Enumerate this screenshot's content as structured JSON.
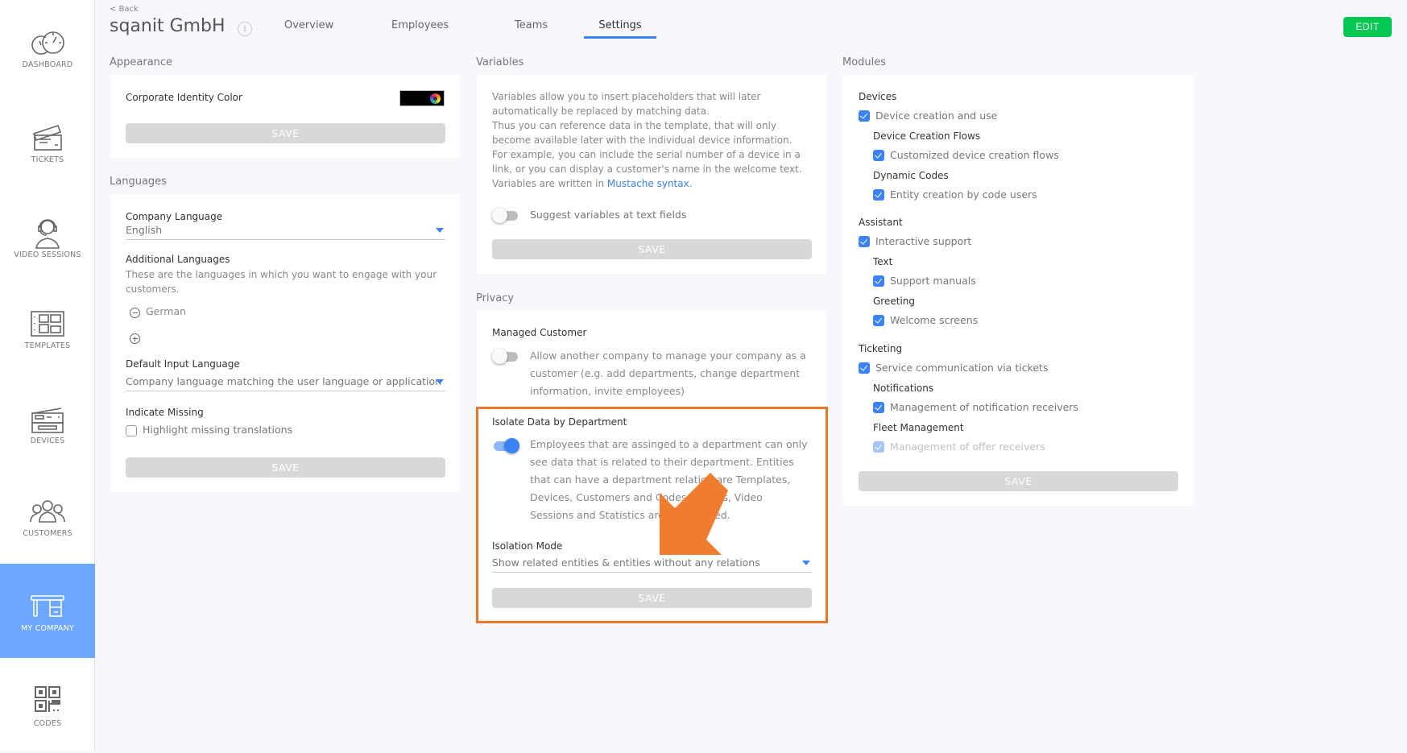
{
  "sidebar": {
    "items": [
      {
        "label": "DASHBOARD",
        "icon": "dashboard-gauge-icon",
        "active": false
      },
      {
        "label": "TICKETS",
        "icon": "tickets-icon",
        "active": false
      },
      {
        "label": "VIDEO SESSIONS",
        "icon": "headset-agent-icon",
        "active": false
      },
      {
        "label": "TEMPLATES",
        "icon": "templates-icon",
        "active": false
      },
      {
        "label": "DEVICES",
        "icon": "printer-device-icon",
        "active": false
      },
      {
        "label": "CUSTOMERS",
        "icon": "users-group-icon",
        "active": false
      },
      {
        "label": "MY COMPANY",
        "icon": "desk-icon",
        "active": true
      },
      {
        "label": "CODES",
        "icon": "qr-code-icon",
        "active": false
      }
    ]
  },
  "header": {
    "back_label": "< Back",
    "title": "sqanit GmbH",
    "info_icon": "i",
    "tabs": [
      {
        "label": "Overview",
        "active": false
      },
      {
        "label": "Employees",
        "active": false
      },
      {
        "label": "Teams",
        "active": false
      },
      {
        "label": "Settings",
        "active": true
      }
    ],
    "edit_label": "EDIT"
  },
  "appearance": {
    "title": "Appearance",
    "color_label": "Corporate Identity Color",
    "color_value": "#000000",
    "save_label": "SAVE"
  },
  "languages": {
    "title": "Languages",
    "company_language_label": "Company Language",
    "company_language_value": "English",
    "additional_label": "Additional Languages",
    "additional_desc": "These are the languages in which you want to engage with your customers.",
    "additional_items": [
      "German"
    ],
    "default_input_label": "Default Input Language",
    "default_input_value": "Company language matching the user language or application language",
    "indicate_missing_label": "Indicate Missing",
    "highlight_label": "Highlight missing translations",
    "highlight_checked": false,
    "save_label": "SAVE"
  },
  "variables": {
    "title": "Variables",
    "desc_line1": "Variables allow you to insert placeholders that will later automatically be replaced by matching data.",
    "desc_line2": "Thus you can reference data in the template, that will only become available later with the individual device information.",
    "desc_line3": "For example, you can include the serial number of a device in a link, or you can display a customer's name in the welcome text.",
    "desc_line4_prefix": "Variables are written in ",
    "desc_link": "Mustache syntax",
    "desc_line4_suffix": ".",
    "suggest_label": "Suggest variables at text fields",
    "suggest_on": false,
    "save_label": "SAVE"
  },
  "privacy": {
    "title": "Privacy",
    "managed_label": "Managed Customer",
    "managed_desc": "Allow another company to manage your company as a customer (e.g. add departments, change department information, invite employees)",
    "managed_on": false,
    "isolate_label": "Isolate Data by Department",
    "isolate_desc": "Employees that are assinged to a department can only see data that is related to their department. Entities that can have a department relation are Templates, Devices, Customers and Codes. Tickets, Video Sessions and Statistics are also filtered.",
    "isolate_on": true,
    "isolation_mode_label": "Isolation Mode",
    "isolation_mode_value": "Show related entities & entities without any relations",
    "save_label": "SAVE"
  },
  "modules": {
    "title": "Modules",
    "groups": [
      {
        "heading": "Devices",
        "item": "Device creation and use",
        "sub": [
          {
            "heading": "Device Creation Flows",
            "item": "Customized device creation flows"
          },
          {
            "heading": "Dynamic Codes",
            "item": "Entity creation by code users"
          }
        ]
      },
      {
        "heading": "Assistant",
        "item": "Interactive support",
        "sub": [
          {
            "heading": "Text",
            "item": "Support manuals"
          },
          {
            "heading": "Greeting",
            "item": "Welcome screens"
          }
        ]
      },
      {
        "heading": "Ticketing",
        "item": "Service communication via tickets",
        "sub": [
          {
            "heading": "Notifications",
            "item": "Management of notification receivers"
          },
          {
            "heading": "Fleet Management",
            "item": "Management of offer receivers"
          }
        ]
      }
    ],
    "save_label": "SAVE"
  },
  "annotation": {
    "highlight_color": "#e8762c",
    "arrow_color": "#ef7c2f"
  }
}
